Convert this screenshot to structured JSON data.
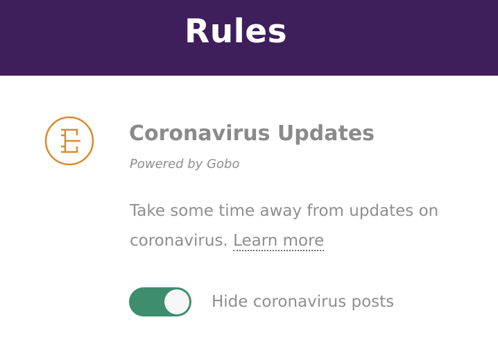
{
  "header": {
    "title": "Rules",
    "background_color": "#3f1e5c"
  },
  "rule": {
    "icon": "gobo-rule-icon",
    "icon_color": "#d98a2b",
    "title": "Coronavirus Updates",
    "subtitle": "Powered by Gobo",
    "description": "Take some time away from updates on coronavirus.",
    "learn_more_label": "Learn more"
  },
  "toggle": {
    "label": "Hide coronavirus posts",
    "checked": true,
    "on_color": "#3c8e6c"
  }
}
